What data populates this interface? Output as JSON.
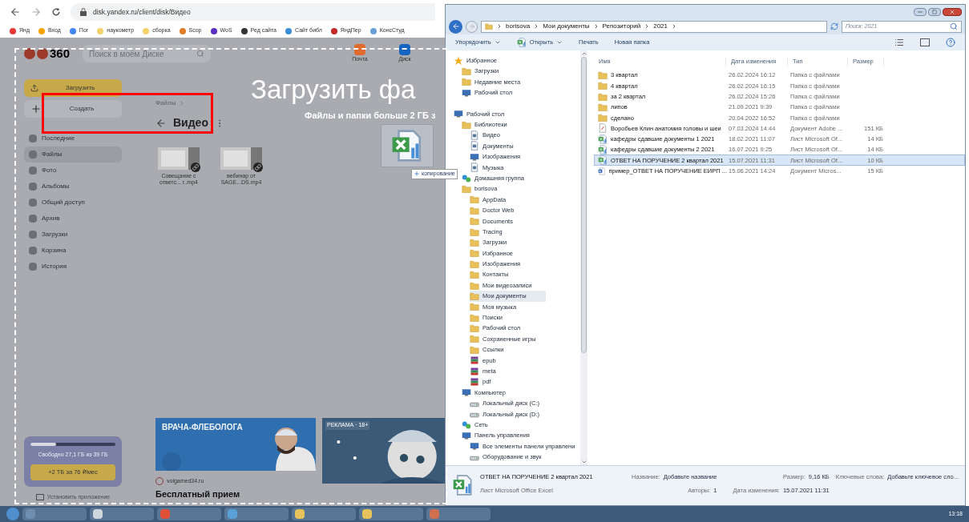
{
  "browser": {
    "url": "disk.yandex.ru/client/disk/Видео",
    "bookmarks": [
      {
        "label": "Янд",
        "color": "#e53935"
      },
      {
        "label": "Вход",
        "color": "#f4a300"
      },
      {
        "label": "Пог",
        "color": "#4285f4"
      },
      {
        "label": "наукометр",
        "color": "#f5d26b"
      },
      {
        "label": "сборка",
        "color": "#f5d26b"
      },
      {
        "label": "Scop",
        "color": "#e07b26"
      },
      {
        "label": "WoS",
        "color": "#5b2fc2"
      },
      {
        "label": "Ред сайта",
        "color": "#333333"
      },
      {
        "label": "Сайт библ",
        "color": "#3b8fd6"
      },
      {
        "label": "ЯндПер",
        "color": "#c62828"
      },
      {
        "label": "КонсСтуд",
        "color": "#6aa0d8"
      }
    ]
  },
  "disk": {
    "logo": "360",
    "search": {
      "placeholder": "Поиск в моём Диске"
    },
    "apps": [
      {
        "label": "Почта",
        "color": "#e06b2c"
      },
      {
        "label": "Диск",
        "color": "#1565c0"
      }
    ],
    "upload": "Загрузить",
    "create": "Создать",
    "nav": [
      {
        "label": "Последние",
        "selected": false
      },
      {
        "label": "Файлы",
        "selected": true
      },
      {
        "label": "Фото",
        "selected": false
      },
      {
        "label": "Альбомы",
        "selected": false
      },
      {
        "label": "Общий доступ",
        "selected": false
      },
      {
        "label": "Архив",
        "selected": false
      },
      {
        "label": "Загрузки",
        "selected": false
      },
      {
        "label": "Корзина",
        "selected": false
      },
      {
        "label": "История",
        "selected": false
      }
    ],
    "breadcrumb": "Файлы",
    "title": "Видео",
    "files": [
      {
        "name": "Совещание с ответс... г..mp4"
      },
      {
        "name": "вебинар от SAGE...DS.mp4"
      }
    ],
    "drop_title": "Загрузить фа",
    "drop_subtitle": "Файлы и папки больше 2 ГБ з",
    "drag_badge": "копирование",
    "storage": {
      "level": 0.3,
      "text": "Свободно 27,1 ГБ из 39 ГБ",
      "button": "+2 ТБ за 76 ₽/мес",
      "install": "Установить приложение"
    },
    "ads": [
      {
        "headline": "ВРАЧА-ФЛЕБОЛОГА",
        "site": "volgamed34.ru",
        "caption": "Бесплатный прием"
      },
      {
        "label": "РЕКЛАМА · 18+"
      }
    ]
  },
  "explorer": {
    "path": [
      "borisova",
      "Мои документы",
      "Репозиторий",
      "2021"
    ],
    "search": {
      "placeholder": "Поиск: 2021"
    },
    "toolbar": [
      {
        "label": "Упорядочить",
        "kind": "menu"
      },
      {
        "label": "Открыть",
        "kind": "open"
      },
      {
        "label": "Печать",
        "kind": "plain"
      },
      {
        "label": "Новая папка",
        "kind": "plain"
      }
    ],
    "tree": [
      {
        "label": "Избранное",
        "kind": "star",
        "selected": false,
        "children": [
          {
            "label": "Загрузки",
            "kind": "folder",
            "selected": false
          },
          {
            "label": "Недавние места",
            "kind": "folder",
            "selected": false
          },
          {
            "label": "Рабочий стол",
            "kind": "desktop",
            "selected": false
          }
        ]
      },
      {
        "label": "Рабочий стол",
        "kind": "desktop",
        "selected": false,
        "children": [
          {
            "label": "Библиотеки",
            "kind": "folder",
            "selected": false,
            "children": [
              {
                "label": "Видео",
                "kind": "file",
                "selected": false
              },
              {
                "label": "Документы",
                "kind": "file",
                "selected": false
              },
              {
                "label": "Изображения",
                "kind": "desktop",
                "selected": false
              },
              {
                "label": "Музыка",
                "kind": "file",
                "selected": false
              }
            ]
          },
          {
            "label": "Домашняя группа",
            "kind": "net",
            "selected": false
          },
          {
            "label": "borisova",
            "kind": "folder",
            "selected": false,
            "children": [
              {
                "label": "AppData",
                "kind": "folder",
                "selected": false
              },
              {
                "label": "Doctor Web",
                "kind": "folder",
                "selected": false
              },
              {
                "label": "Documents",
                "kind": "folder",
                "selected": false
              },
              {
                "label": "Tracing",
                "kind": "folder",
                "selected": false
              },
              {
                "label": "Загрузки",
                "kind": "folder",
                "selected": false
              },
              {
                "label": "Избранное",
                "kind": "folder",
                "selected": false
              },
              {
                "label": "Изображения",
                "kind": "folder",
                "selected": false
              },
              {
                "label": "Контакты",
                "kind": "folder",
                "selected": false
              },
              {
                "label": "Мои видеозаписи",
                "kind": "folder",
                "selected": false
              },
              {
                "label": "Мои документы",
                "kind": "folder",
                "selected": true
              },
              {
                "label": "Моя музыка",
                "kind": "folder",
                "selected": false
              },
              {
                "label": "Поиски",
                "kind": "folder",
                "selected": false
              },
              {
                "label": "Рабочий стол",
                "kind": "folder",
                "selected": false
              },
              {
                "label": "Сохраненные игры",
                "kind": "folder",
                "selected": false
              },
              {
                "label": "Ссылки",
                "kind": "folder",
                "selected": false
              },
              {
                "label": "epub",
                "kind": "archive",
                "selected": false
              },
              {
                "label": "meta",
                "kind": "archive",
                "selected": false
              },
              {
                "label": "pdf",
                "kind": "archive",
                "selected": false
              }
            ]
          },
          {
            "label": "Компьютер",
            "kind": "desktop",
            "selected": false,
            "children": [
              {
                "label": "Локальный диск (C:)",
                "kind": "drive",
                "selected": false
              },
              {
                "label": "Локальный диск (D:)",
                "kind": "drive",
                "selected": false
              }
            ]
          },
          {
            "label": "Сеть",
            "kind": "net",
            "selected": false
          },
          {
            "label": "Панель управления",
            "kind": "desktop",
            "selected": false,
            "children": [
              {
                "label": "Все элементы панели управлени",
                "kind": "desktop",
                "selected": false
              },
              {
                "label": "Оборудование и звук",
                "kind": "drive",
                "selected": false
              }
            ]
          }
        ]
      }
    ],
    "columns": [
      "Имя",
      "Дата изменения",
      "Тип",
      "Размер"
    ],
    "rows": [
      {
        "kind": "folder",
        "name": "3 квартал",
        "date": "26.02.2024 16:12",
        "type": "Папка с файлами",
        "selected": false
      },
      {
        "kind": "folder",
        "name": "4 квартал",
        "date": "26.02.2024 16:15",
        "type": "Папка с файлами",
        "selected": false
      },
      {
        "kind": "folder",
        "name": "за 2 квартал",
        "date": "26.02.2024 15:26",
        "type": "Папка с файлами",
        "selected": false
      },
      {
        "kind": "folder",
        "name": "липов",
        "date": "21.09.2021 9:39",
        "type": "Папка с файлами",
        "selected": false
      },
      {
        "kind": "folder",
        "name": "сделано",
        "date": "20.04.2022 16:52",
        "type": "Папка с файлами",
        "selected": false
      },
      {
        "kind": "pdf",
        "name": "Воробьев Клин анатомия головы и шеи",
        "date": "07.03.2024 14:44",
        "type": "Документ Adobe ...",
        "size": "151 КБ",
        "selected": false
      },
      {
        "kind": "excel",
        "name": "кафедры сдавшие документы 1 2021",
        "date": "18.02.2021 11:07",
        "type": "Лист Microsoft Of...",
        "size": "14 КБ",
        "selected": false
      },
      {
        "kind": "excel",
        "name": "кафедры сдавшие документы 2 2021",
        "date": "16.07.2021 9:25",
        "type": "Лист Microsoft Of...",
        "size": "14 КБ",
        "selected": false
      },
      {
        "kind": "excel",
        "name": "ОТВЕТ НА ПОРУЧЕНИЕ 2 квартал  2021",
        "date": "15.07.2021 11:31",
        "type": "Лист Microsoft Of...",
        "size": "10 КБ",
        "selected": true
      },
      {
        "kind": "word",
        "name": "пример_ОТВЕТ НА ПОРУЧЕНИЕ ЕИРП ...",
        "date": "15.06.2021 14:24",
        "type": "Документ Micros...",
        "size": "15 КБ",
        "selected": false
      }
    ],
    "details": {
      "name": "ОТВЕТ НА ПОРУЧЕНИЕ 2 квартал  2021",
      "type": "Лист Microsoft Office Excel",
      "fields": [
        {
          "label": "Название:",
          "value": "Добавьте название"
        },
        {
          "label": "Авторы:",
          "value": "1"
        },
        {
          "label": "Размер:",
          "value": "9,16 КБ"
        },
        {
          "label": "Дата изменения:",
          "value": "15.07.2021 11:31"
        },
        {
          "label": "Ключевые слова:",
          "value": "Добавьте ключевое сло..."
        }
      ]
    }
  },
  "taskbar": {
    "clock": "13:18"
  }
}
